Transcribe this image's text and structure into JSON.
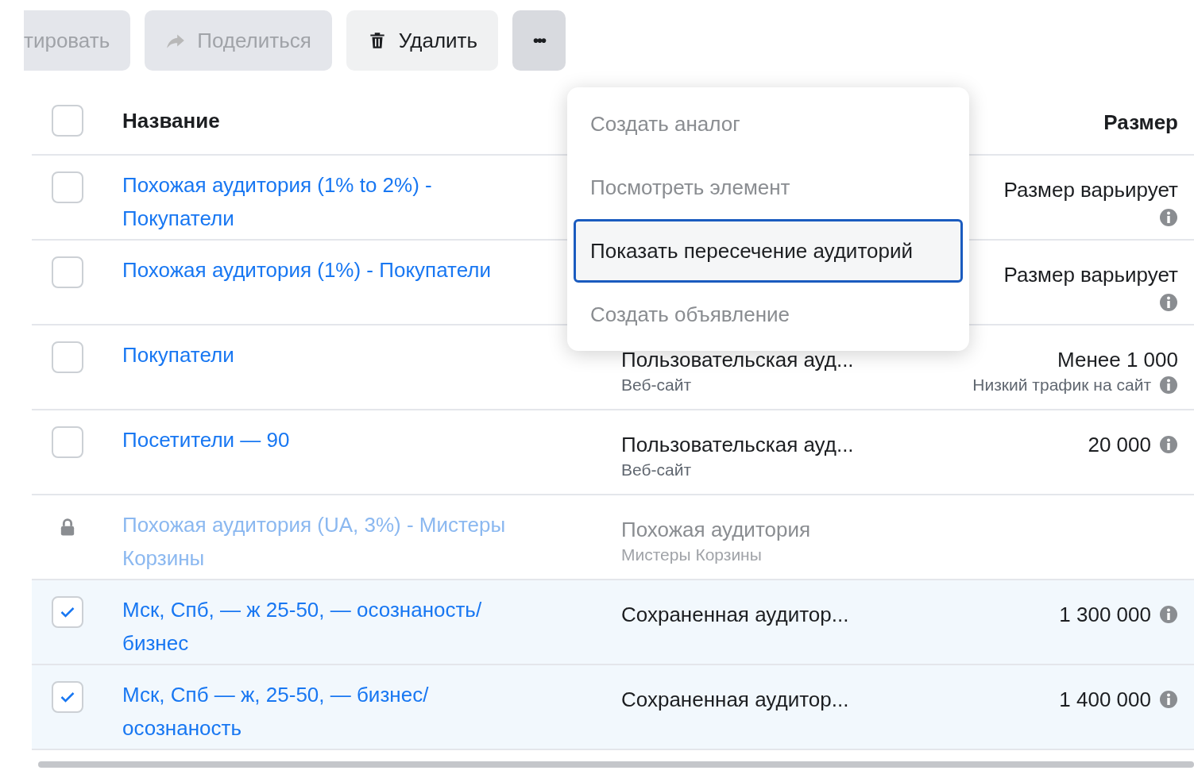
{
  "toolbar": [
    {
      "label": "тировать",
      "kind": "edit",
      "disabled": true
    },
    {
      "label": "Поделиться",
      "kind": "share",
      "disabled": true
    },
    {
      "label": "Удалить",
      "kind": "delete",
      "disabled": false
    },
    {
      "label": "•••",
      "kind": "more",
      "disabled": false
    }
  ],
  "table": {
    "columns": [
      "Название",
      "Размер"
    ],
    "all_checked": false,
    "rows": [
      {
        "kind": "checkbox",
        "checked": false,
        "name": "Похожая аудитория (1% to 2%) - Покупатели",
        "size": "Размер варьирует"
      },
      {
        "kind": "checkbox",
        "checked": false,
        "name": "Похожая аудитория (1%) - Покупатели",
        "size": "Размер варьирует"
      },
      {
        "kind": "checkbox",
        "checked": false,
        "name": "Покупатели",
        "type": "Пользовательская ауд...",
        "source": "Веб-сайт",
        "size": "Менее 1 000",
        "size_note": "Низкий трафик на сайт"
      },
      {
        "kind": "checkbox",
        "checked": false,
        "name": "Посетители — 90",
        "type": "Пользовательская ауд...",
        "source": "Веб-сайт",
        "size": "20 000"
      },
      {
        "kind": "locked",
        "name": "Похожая аудитория (UA, 3%) - Мистеры Корзины",
        "type": "Похожая аудитория",
        "source": "Мистеры Корзины"
      },
      {
        "kind": "checkbox",
        "checked": true,
        "name": "Мск, Спб, — ж 25-50, — осознаность/ бизнес",
        "type": "Сохраненная аудитор...",
        "size": "1 300 000"
      },
      {
        "kind": "checkbox",
        "checked": true,
        "name": "Мск, Спб — ж, 25-50, — бизнес/ осознаность",
        "type": "Сохраненная аудитор...",
        "size": "1 400 000"
      }
    ]
  },
  "menu": [
    {
      "label": "Создать аналог",
      "selected": false
    },
    {
      "label": "Посмотреть элемент",
      "selected": false
    },
    {
      "label": "Показать пересечение аудиторий",
      "selected": true
    },
    {
      "label": "Создать объявление",
      "selected": false
    }
  ]
}
